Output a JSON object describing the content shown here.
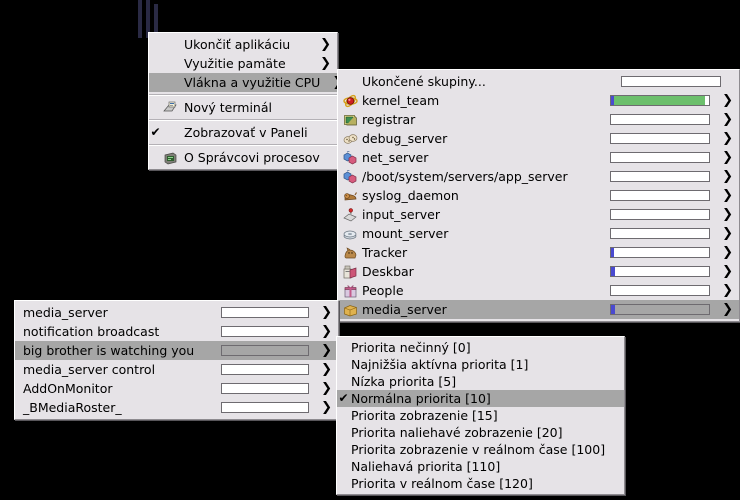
{
  "replicant": {
    "name": "cpu-usage-replicant",
    "bar_color": "#2a2a44",
    "bars": [
      100,
      100,
      89
    ]
  },
  "menu_main": {
    "items": [
      {
        "label": "Ukončiť aplikáciu",
        "arrow": "❯",
        "selected": false,
        "icon": null,
        "check": ""
      },
      {
        "label": "Využitie pamäte",
        "arrow": "❯",
        "selected": false,
        "icon": null,
        "check": ""
      },
      {
        "label": "Vlákna a využitie CPU",
        "arrow": "❯",
        "selected": true,
        "icon": null,
        "check": ""
      },
      {
        "separator": true
      },
      {
        "label": "Nový terminál",
        "arrow": "",
        "selected": false,
        "icon": "terminal-icon",
        "check": ""
      },
      {
        "separator": true
      },
      {
        "label": "Zobrazovať v Paneli",
        "arrow": "",
        "selected": false,
        "icon": null,
        "check": "✔"
      },
      {
        "separator": true
      },
      {
        "label": "O Správcovi procesov",
        "arrow": "",
        "selected": false,
        "icon": "about-icon",
        "check": ""
      }
    ]
  },
  "menu_teams": {
    "items": [
      {
        "label": "Ukončené skupiny...",
        "icon": null,
        "arrow": "",
        "selected": false,
        "gauge": {
          "blue": 0,
          "green": 0
        }
      },
      {
        "label": "kernel_team",
        "icon": "kernel-icon",
        "arrow": "❯",
        "selected": false,
        "gauge": {
          "blue": 3,
          "green": 93
        }
      },
      {
        "label": "registrar",
        "icon": "registrar-icon",
        "arrow": "❯",
        "selected": false,
        "gauge": {
          "blue": 0,
          "green": 0
        }
      },
      {
        "label": "debug_server",
        "icon": "debug-icon",
        "arrow": "❯",
        "selected": false,
        "gauge": {
          "blue": 0,
          "green": 0
        }
      },
      {
        "label": "net_server",
        "icon": "net-icon",
        "arrow": "❯",
        "selected": false,
        "gauge": {
          "blue": 0,
          "green": 0
        }
      },
      {
        "label": "/boot/system/servers/app_server",
        "icon": "app-server-icon",
        "arrow": "❯",
        "selected": false,
        "gauge": {
          "blue": 0,
          "green": 0
        }
      },
      {
        "label": "syslog_daemon",
        "icon": "syslog-icon",
        "arrow": "❯",
        "selected": false,
        "gauge": {
          "blue": 0,
          "green": 0
        }
      },
      {
        "label": "input_server",
        "icon": "input-icon",
        "arrow": "❯",
        "selected": false,
        "gauge": {
          "blue": 0,
          "green": 0
        }
      },
      {
        "label": "mount_server",
        "icon": "mount-icon",
        "arrow": "❯",
        "selected": false,
        "gauge": {
          "blue": 0,
          "green": 0
        }
      },
      {
        "label": "Tracker",
        "icon": "tracker-icon",
        "arrow": "❯",
        "selected": false,
        "gauge": {
          "blue": 3,
          "green": 0
        }
      },
      {
        "label": "Deskbar",
        "icon": "deskbar-icon",
        "arrow": "❯",
        "selected": false,
        "gauge": {
          "blue": 4,
          "green": 0
        }
      },
      {
        "label": "People",
        "icon": "people-icon",
        "arrow": "❯",
        "selected": false,
        "gauge": {
          "blue": 0,
          "green": 0
        }
      },
      {
        "label": "media_server",
        "icon": "media-icon",
        "arrow": "❯",
        "selected": true,
        "gauge": {
          "blue": 4,
          "green": 0
        }
      }
    ]
  },
  "menu_threads": {
    "items": [
      {
        "label": "media_server",
        "arrow": "❯",
        "selected": false,
        "gauge": {
          "blue": 0,
          "green": 0
        }
      },
      {
        "label": "notification broadcast",
        "arrow": "❯",
        "selected": false,
        "gauge": {
          "blue": 0,
          "green": 0
        }
      },
      {
        "label": "big brother is watching you",
        "arrow": "❯",
        "selected": true,
        "gauge": {
          "blue": 0,
          "green": 0
        }
      },
      {
        "label": "media_server control",
        "arrow": "❯",
        "selected": false,
        "gauge": {
          "blue": 0,
          "green": 0
        }
      },
      {
        "label": "AddOnMonitor",
        "arrow": "❯",
        "selected": false,
        "gauge": {
          "blue": 0,
          "green": 0
        }
      },
      {
        "label": "_BMediaRoster_",
        "arrow": "❯",
        "selected": false,
        "gauge": {
          "blue": 0,
          "green": 0
        }
      }
    ]
  },
  "menu_priority": {
    "items": [
      {
        "label": "Priorita nečinný [0]",
        "check": "",
        "selected": false
      },
      {
        "label": "Najnižšia aktívna priorita [1]",
        "check": "",
        "selected": false
      },
      {
        "label": "Nízka priorita [5]",
        "check": "",
        "selected": false
      },
      {
        "label": "Normálna priorita [10]",
        "check": "✔",
        "selected": true
      },
      {
        "label": "Priorita zobrazenie [15]",
        "check": "",
        "selected": false
      },
      {
        "label": "Priorita naliehavé zobrazenie [20]",
        "check": "",
        "selected": false
      },
      {
        "label": "Priorita zobrazenie v reálnom čase [100]",
        "check": "",
        "selected": false
      },
      {
        "label": "Naliehavá priorita [110]",
        "check": "",
        "selected": false
      },
      {
        "label": "Priorita v reálnom čase [120]",
        "check": "",
        "selected": false
      }
    ]
  },
  "colors": {
    "menu_bg": "#e6e3e7",
    "menu_selected": "#a6a6a6",
    "gauge_green": "#6cbf6c",
    "gauge_blue": "#4a4ad0",
    "desktop": "#000000"
  }
}
